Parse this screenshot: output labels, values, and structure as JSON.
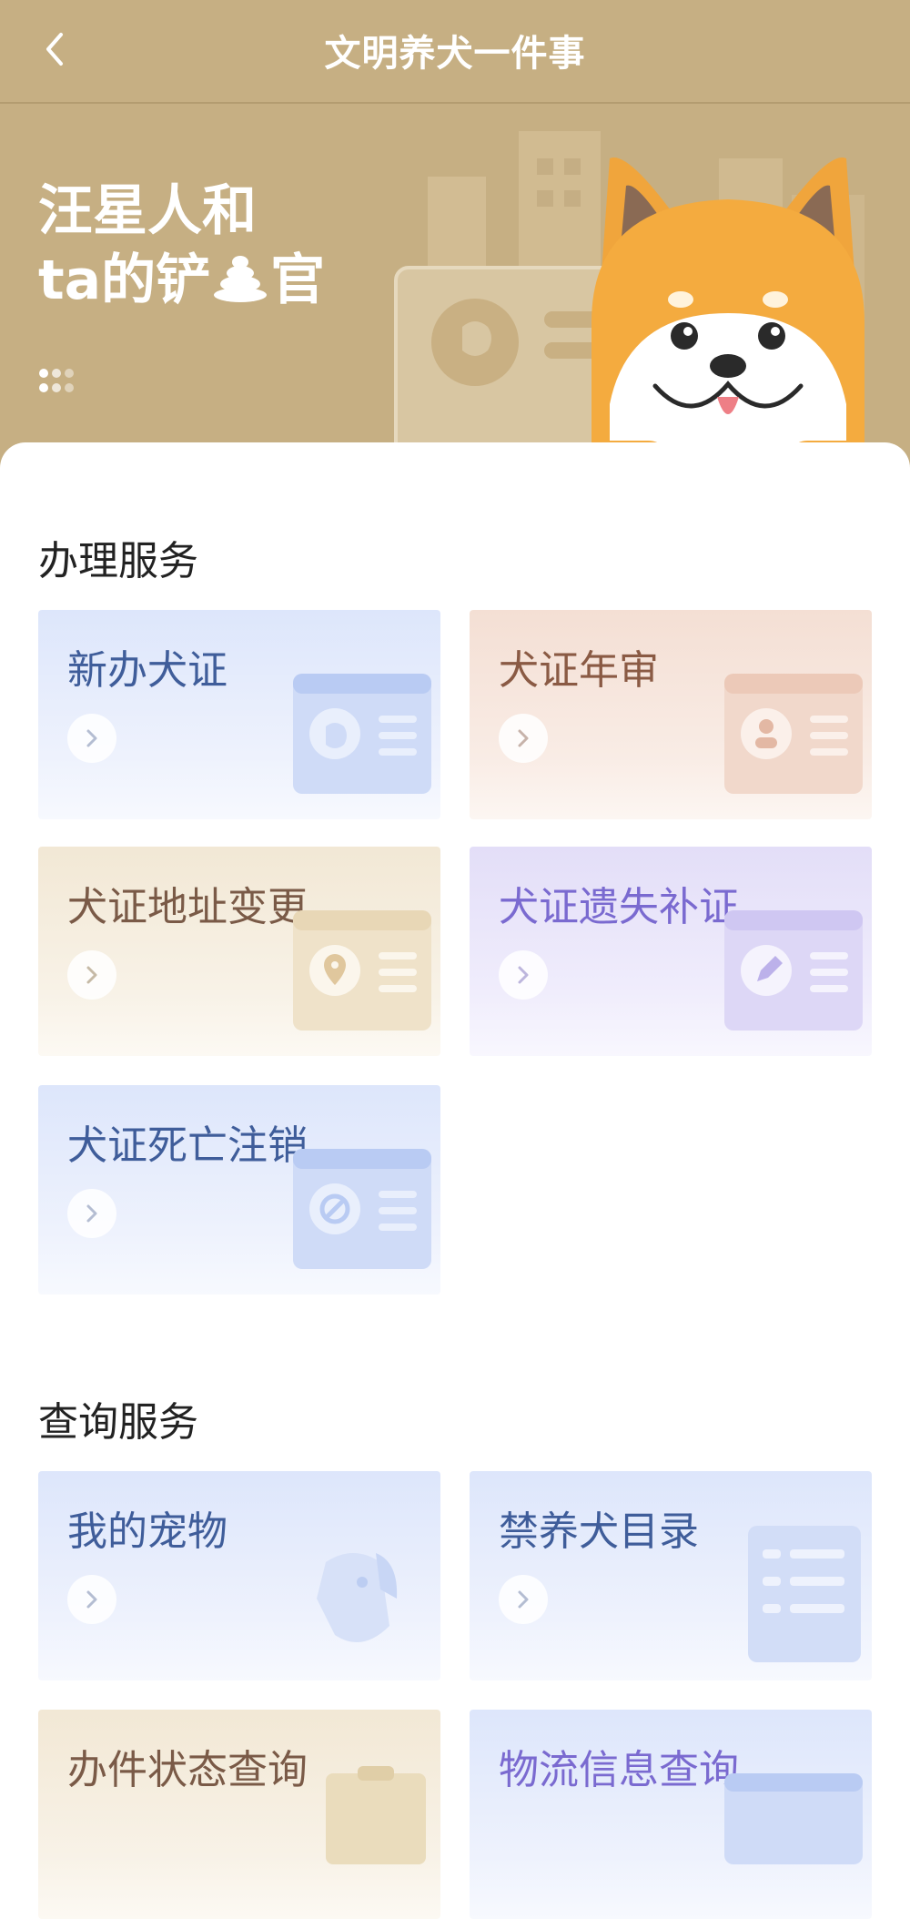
{
  "header": {
    "title": "文明养犬一件事",
    "back_icon": "chevron-left-icon"
  },
  "banner": {
    "slogan_line1": "汪星人和",
    "slogan_line2_a": "ta的铲",
    "slogan_line2_b": "官",
    "poop_icon": "poop-icon",
    "mascot": "shiba-dog-mascot"
  },
  "services": {
    "title": "办理服务",
    "items": [
      {
        "label": "新办犬证",
        "icon": "dog-card-icon"
      },
      {
        "label": "犬证年审",
        "icon": "person-card-icon"
      },
      {
        "label": "犬证地址变更",
        "icon": "location-card-icon"
      },
      {
        "label": "犬证遗失补证",
        "icon": "pencil-card-icon"
      },
      {
        "label": "犬证死亡注销",
        "icon": "cancel-card-icon"
      }
    ]
  },
  "query": {
    "title": "查询服务",
    "items": [
      {
        "label": "我的宠物",
        "icon": "dog-head-icon"
      },
      {
        "label": "禁养犬目录",
        "icon": "list-document-icon"
      },
      {
        "label": "办件状态查询",
        "icon": "clipboard-icon"
      },
      {
        "label": "物流信息查询",
        "icon": "card-icon"
      }
    ]
  },
  "colors": {
    "header_bg": "#c6af83",
    "blue_text": "#3f5d9a",
    "brown_text": "#8a5a44",
    "purple_text": "#7a6ad0"
  }
}
